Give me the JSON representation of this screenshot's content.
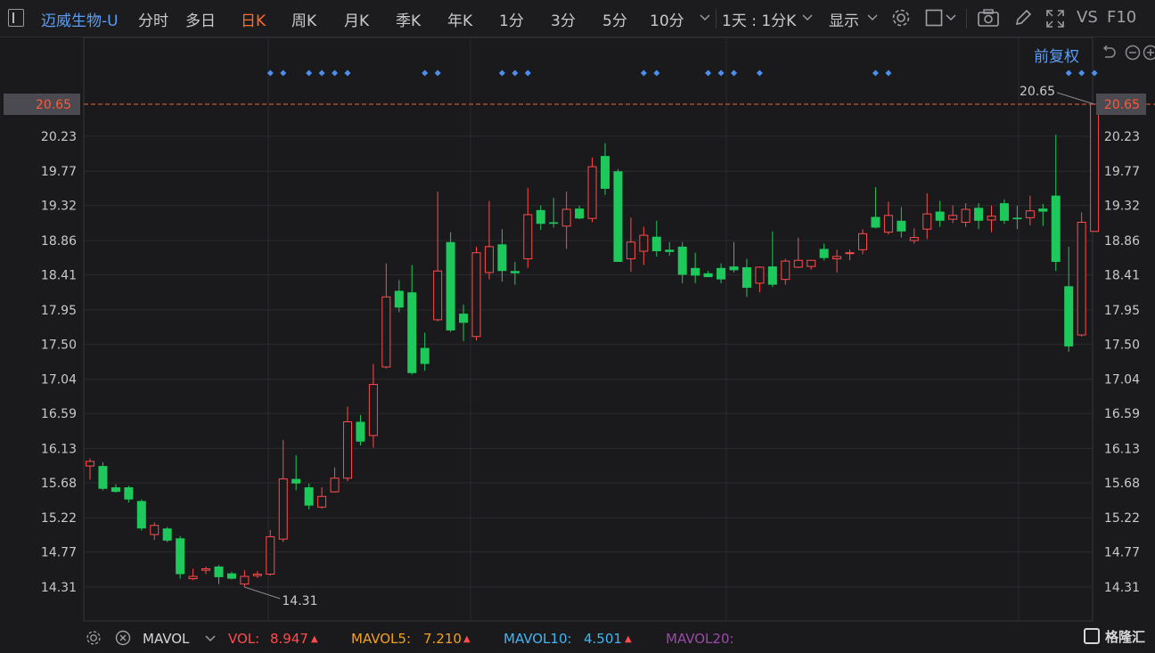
{
  "toolbar": {
    "stock_name": "迈威生物-U",
    "periods": [
      "分时",
      "多日",
      "日K",
      "周K",
      "月K",
      "季K",
      "年K",
      "1分",
      "3分",
      "5分",
      "10分"
    ],
    "active_period": "日K",
    "combo_select": "1天 : 1分K",
    "display_label": "显示",
    "vs_label": "VS",
    "f10_label": "F10"
  },
  "chart_header": {
    "adjust_label": "前复权"
  },
  "chart_data": {
    "type": "candlestick",
    "y_ticks": [
      "20.65",
      "20.23",
      "19.77",
      "19.32",
      "18.86",
      "18.41",
      "17.95",
      "17.50",
      "17.04",
      "16.59",
      "16.13",
      "15.68",
      "15.22",
      "14.77",
      "14.31"
    ],
    "ylim": [
      14.31,
      20.65
    ],
    "current_price_label": "20.65",
    "max_label": "20.65",
    "min_label": "14.31",
    "candles": [
      {
        "o": 15.9,
        "h": 16.0,
        "l": 15.72,
        "c": 15.96
      },
      {
        "o": 15.9,
        "h": 15.95,
        "l": 15.58,
        "c": 15.6
      },
      {
        "o": 15.62,
        "h": 15.66,
        "l": 15.55,
        "c": 15.56
      },
      {
        "o": 15.62,
        "h": 15.64,
        "l": 15.42,
        "c": 15.46
      },
      {
        "o": 15.44,
        "h": 15.46,
        "l": 15.05,
        "c": 15.08
      },
      {
        "o": 15.0,
        "h": 15.16,
        "l": 14.93,
        "c": 15.12
      },
      {
        "o": 15.08,
        "h": 15.1,
        "l": 14.9,
        "c": 14.92
      },
      {
        "o": 14.95,
        "h": 14.98,
        "l": 14.42,
        "c": 14.48
      },
      {
        "o": 14.42,
        "h": 14.55,
        "l": 14.4,
        "c": 14.45
      },
      {
        "o": 14.53,
        "h": 14.58,
        "l": 14.48,
        "c": 14.55
      },
      {
        "o": 14.58,
        "h": 14.6,
        "l": 14.35,
        "c": 14.44
      },
      {
        "o": 14.49,
        "h": 14.51,
        "l": 14.41,
        "c": 14.42
      },
      {
        "o": 14.35,
        "h": 14.53,
        "l": 14.31,
        "c": 14.45
      },
      {
        "o": 14.46,
        "h": 14.52,
        "l": 14.43,
        "c": 14.48
      },
      {
        "o": 14.48,
        "h": 15.06,
        "l": 14.46,
        "c": 14.97
      },
      {
        "o": 14.94,
        "h": 16.24,
        "l": 14.9,
        "c": 15.73
      },
      {
        "o": 15.73,
        "h": 16.04,
        "l": 15.58,
        "c": 15.67
      },
      {
        "o": 15.62,
        "h": 15.67,
        "l": 15.33,
        "c": 15.38
      },
      {
        "o": 15.36,
        "h": 15.62,
        "l": 15.34,
        "c": 15.5
      },
      {
        "o": 15.56,
        "h": 15.88,
        "l": 15.55,
        "c": 15.74
      },
      {
        "o": 15.74,
        "h": 16.68,
        "l": 15.7,
        "c": 16.48
      },
      {
        "o": 16.48,
        "h": 16.57,
        "l": 16.17,
        "c": 16.22
      },
      {
        "o": 16.3,
        "h": 17.24,
        "l": 16.14,
        "c": 16.97
      },
      {
        "o": 17.2,
        "h": 18.56,
        "l": 17.18,
        "c": 18.12
      },
      {
        "o": 18.2,
        "h": 18.34,
        "l": 17.92,
        "c": 17.98
      },
      {
        "o": 18.18,
        "h": 18.54,
        "l": 17.1,
        "c": 17.12
      },
      {
        "o": 17.45,
        "h": 17.65,
        "l": 17.15,
        "c": 17.24
      },
      {
        "o": 17.82,
        "h": 19.5,
        "l": 17.8,
        "c": 18.46
      },
      {
        "o": 18.84,
        "h": 18.97,
        "l": 17.66,
        "c": 17.68
      },
      {
        "o": 17.9,
        "h": 18.02,
        "l": 17.54,
        "c": 17.78
      },
      {
        "o": 17.6,
        "h": 18.78,
        "l": 17.55,
        "c": 18.7
      },
      {
        "o": 18.44,
        "h": 19.38,
        "l": 18.35,
        "c": 18.78
      },
      {
        "o": 18.81,
        "h": 19.01,
        "l": 18.32,
        "c": 18.46
      },
      {
        "o": 18.46,
        "h": 18.58,
        "l": 18.28,
        "c": 18.43
      },
      {
        "o": 18.62,
        "h": 19.55,
        "l": 18.5,
        "c": 19.2
      },
      {
        "o": 19.26,
        "h": 19.32,
        "l": 19.0,
        "c": 19.08
      },
      {
        "o": 19.1,
        "h": 19.42,
        "l": 19.03,
        "c": 19.08
      },
      {
        "o": 19.05,
        "h": 19.5,
        "l": 18.75,
        "c": 19.27
      },
      {
        "o": 19.28,
        "h": 19.32,
        "l": 19.14,
        "c": 19.15
      },
      {
        "o": 19.15,
        "h": 19.95,
        "l": 19.1,
        "c": 19.83
      },
      {
        "o": 19.97,
        "h": 20.14,
        "l": 19.46,
        "c": 19.54
      },
      {
        "o": 19.77,
        "h": 19.8,
        "l": 18.58,
        "c": 18.58
      },
      {
        "o": 18.62,
        "h": 19.16,
        "l": 18.45,
        "c": 18.84
      },
      {
        "o": 18.72,
        "h": 19.04,
        "l": 18.54,
        "c": 18.93
      },
      {
        "o": 18.91,
        "h": 19.12,
        "l": 18.65,
        "c": 18.72
      },
      {
        "o": 18.74,
        "h": 18.84,
        "l": 18.66,
        "c": 18.71
      },
      {
        "o": 18.78,
        "h": 18.84,
        "l": 18.3,
        "c": 18.41
      },
      {
        "o": 18.5,
        "h": 18.7,
        "l": 18.3,
        "c": 18.4
      },
      {
        "o": 18.43,
        "h": 18.46,
        "l": 18.38,
        "c": 18.38
      },
      {
        "o": 18.5,
        "h": 18.56,
        "l": 18.3,
        "c": 18.35
      },
      {
        "o": 18.52,
        "h": 18.84,
        "l": 18.44,
        "c": 18.47
      },
      {
        "o": 18.51,
        "h": 18.62,
        "l": 18.12,
        "c": 18.24
      },
      {
        "o": 18.3,
        "h": 18.52,
        "l": 18.18,
        "c": 18.51
      },
      {
        "o": 18.52,
        "h": 18.98,
        "l": 18.25,
        "c": 18.28
      },
      {
        "o": 18.35,
        "h": 18.62,
        "l": 18.28,
        "c": 18.59
      },
      {
        "o": 18.51,
        "h": 18.9,
        "l": 18.5,
        "c": 18.6
      },
      {
        "o": 18.52,
        "h": 18.6,
        "l": 18.48,
        "c": 18.6
      },
      {
        "o": 18.75,
        "h": 18.82,
        "l": 18.6,
        "c": 18.63
      },
      {
        "o": 18.62,
        "h": 18.74,
        "l": 18.44,
        "c": 18.65
      },
      {
        "o": 18.69,
        "h": 18.74,
        "l": 18.6,
        "c": 18.7
      },
      {
        "o": 18.74,
        "h": 19.01,
        "l": 18.68,
        "c": 18.95
      },
      {
        "o": 19.17,
        "h": 19.56,
        "l": 19.02,
        "c": 19.03
      },
      {
        "o": 18.97,
        "h": 19.37,
        "l": 18.94,
        "c": 19.19
      },
      {
        "o": 19.12,
        "h": 19.3,
        "l": 18.9,
        "c": 18.98
      },
      {
        "o": 18.86,
        "h": 19.02,
        "l": 18.82,
        "c": 18.9
      },
      {
        "o": 19.01,
        "h": 19.48,
        "l": 18.88,
        "c": 19.21
      },
      {
        "o": 19.24,
        "h": 19.38,
        "l": 19.04,
        "c": 19.12
      },
      {
        "o": 19.14,
        "h": 19.32,
        "l": 19.09,
        "c": 19.19
      },
      {
        "o": 19.1,
        "h": 19.35,
        "l": 19.04,
        "c": 19.27
      },
      {
        "o": 19.29,
        "h": 19.35,
        "l": 19.01,
        "c": 19.12
      },
      {
        "o": 19.13,
        "h": 19.32,
        "l": 18.97,
        "c": 19.18
      },
      {
        "o": 19.35,
        "h": 19.4,
        "l": 19.08,
        "c": 19.12
      },
      {
        "o": 19.16,
        "h": 19.32,
        "l": 19.01,
        "c": 19.14
      },
      {
        "o": 19.16,
        "h": 19.45,
        "l": 19.06,
        "c": 19.25
      },
      {
        "o": 19.28,
        "h": 19.34,
        "l": 19.05,
        "c": 19.24
      },
      {
        "o": 19.45,
        "h": 20.25,
        "l": 18.46,
        "c": 18.58
      },
      {
        "o": 18.26,
        "h": 18.78,
        "l": 17.4,
        "c": 17.47
      },
      {
        "o": 17.62,
        "h": 19.23,
        "l": 17.6,
        "c": 19.1
      },
      {
        "o": 18.98,
        "h": 20.65,
        "l": 18.98,
        "c": 20.65
      }
    ],
    "event_markers": [
      14,
      15,
      17,
      18,
      19,
      20,
      26,
      27,
      32,
      33,
      34,
      43,
      44,
      48,
      49,
      50,
      52,
      61,
      62,
      76,
      77,
      78
    ],
    "colors": {
      "up": "#ff4b4b",
      "down": "#1ec95b",
      "grid": "#2b2b30",
      "axis_text": "#c9c9cc",
      "price_line": "#e26a3a",
      "marker": "#4c8ff0"
    }
  },
  "indicator_bar": {
    "name": "MAVOL",
    "vol_label": "VOL:",
    "vol_value": "8.947",
    "mavol5_label": "MAVOL5:",
    "mavol5_value": "7.210",
    "mavol10_label": "MAVOL10:",
    "mavol10_value": "4.501",
    "mavol20_label": "MAVOL20:",
    "colors": {
      "vol": "#ff4b4b",
      "mavol5": "#f0a020",
      "mavol10": "#3fb6f2",
      "mavol20": "#9a4aa8"
    }
  },
  "watermark": "格隆汇"
}
